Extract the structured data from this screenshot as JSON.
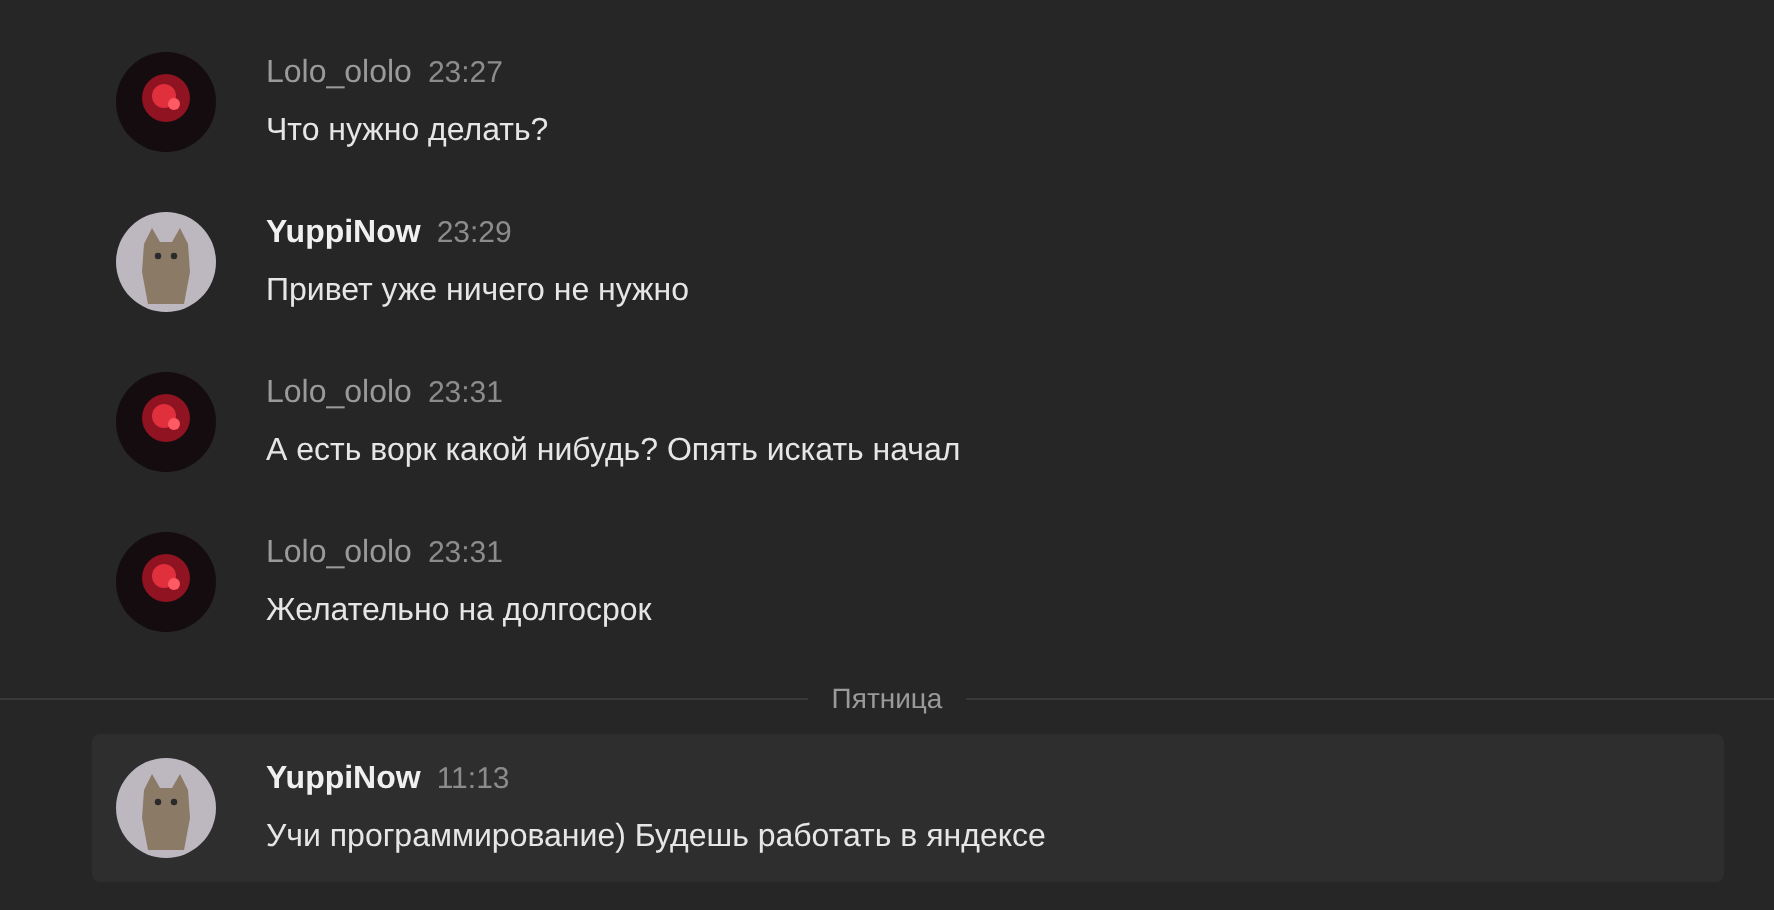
{
  "messages": [
    {
      "kind": "other",
      "author": "Lolo_ololo",
      "time": "23:27",
      "text": "Что нужно делать?",
      "highlighted": false
    },
    {
      "kind": "self",
      "author": "YuppiNow",
      "time": "23:29",
      "text": "Привет уже ничего не нужно",
      "highlighted": false
    },
    {
      "kind": "other",
      "author": "Lolo_ololo",
      "time": "23:31",
      "text": "А есть ворк какой нибудь? Опять искать начал",
      "highlighted": false
    },
    {
      "kind": "other",
      "author": "Lolo_ololo",
      "time": "23:31",
      "text": "Желательно на долгосрок",
      "highlighted": false
    },
    {
      "kind": "divider",
      "label": "Пятница"
    },
    {
      "kind": "self",
      "author": "YuppiNow",
      "time": "11:13",
      "text": "Учи программирование) Будешь работать в яндексе",
      "highlighted": true
    }
  ]
}
